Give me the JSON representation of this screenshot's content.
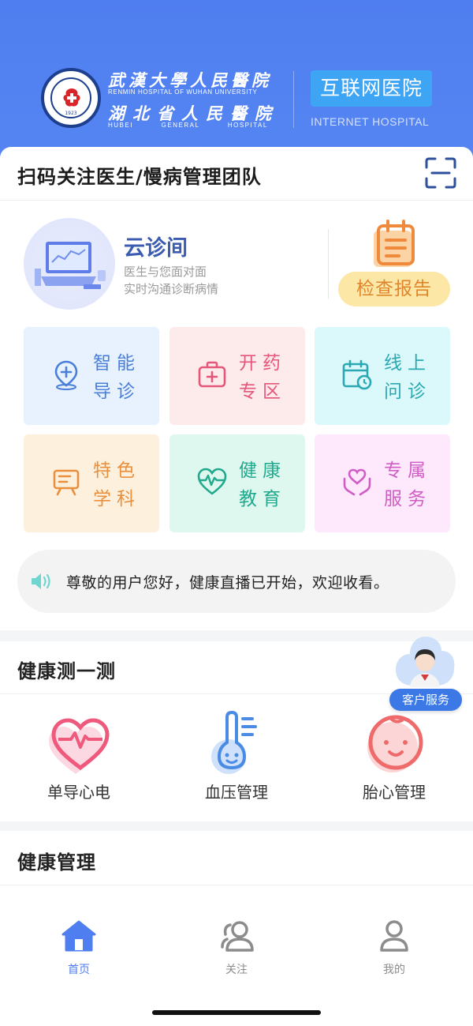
{
  "header": {
    "hospital_cn_1": "武漢大學人民醫院",
    "hospital_en_1": "RENMIN HOSPITAL OF WUHAN UNIVERSITY",
    "hospital_cn_2": "湖北省人民醫院",
    "hospital_en_2": "HUBEI GENERAL HOSPITAL",
    "logo_year": "1923",
    "internet_hospital_cn": "互联网医院",
    "internet_hospital_en": "INTERNET HOSPITAL",
    "brand_color": "#4f7ef0"
  },
  "scan": {
    "title": "扫码关注医生/慢病管理团队",
    "icon": "scan-icon"
  },
  "cloud_clinic": {
    "title": "云诊间",
    "line1": "医生与您面对面",
    "line2": "实时沟通诊断病情"
  },
  "report": {
    "label": "检查报告",
    "icon": "clipboard-icon"
  },
  "tiles": [
    {
      "l1": "智能",
      "l2": "导诊",
      "icon": "location-plus-icon",
      "bg": "#e8f1fe",
      "color": "#4a7fd9"
    },
    {
      "l1": "开药",
      "l2": "专区",
      "icon": "medical-kit-icon",
      "bg": "#fdeaea",
      "color": "#e5577a"
    },
    {
      "l1": "线上",
      "l2": "问诊",
      "icon": "calendar-clock-icon",
      "bg": "#dbf8fb",
      "color": "#2aa9b3"
    },
    {
      "l1": "特色",
      "l2": "学科",
      "icon": "presentation-board-icon",
      "bg": "#fdf1de",
      "color": "#ea8f3b"
    },
    {
      "l1": "健康",
      "l2": "教育",
      "icon": "heartbeat-icon",
      "bg": "#dff8ef",
      "color": "#21a98d"
    },
    {
      "l1": "专属",
      "l2": "服务",
      "icon": "hands-heart-icon",
      "bg": "#fde9fb",
      "color": "#d15cc6"
    }
  ],
  "notice": {
    "text": "尊敬的用户您好，健康直播已开始，欢迎收看。",
    "icon": "speaker-icon"
  },
  "health_test": {
    "title": "健康测一测",
    "items": [
      {
        "label": "单导心电",
        "icon": "heart-ecg-icon"
      },
      {
        "label": "血压管理",
        "icon": "thermometer-face-icon"
      },
      {
        "label": "胎心管理",
        "icon": "baby-face-icon"
      }
    ]
  },
  "customer_service": {
    "label": "客户服务"
  },
  "health_manage": {
    "title": "健康管理"
  },
  "tabbar": {
    "items": [
      {
        "label": "首页",
        "icon": "home-icon",
        "active": true
      },
      {
        "label": "关注",
        "icon": "users-icon",
        "active": false
      },
      {
        "label": "我的",
        "icon": "user-icon",
        "active": false
      }
    ],
    "active_color": "#4f7ef0"
  }
}
